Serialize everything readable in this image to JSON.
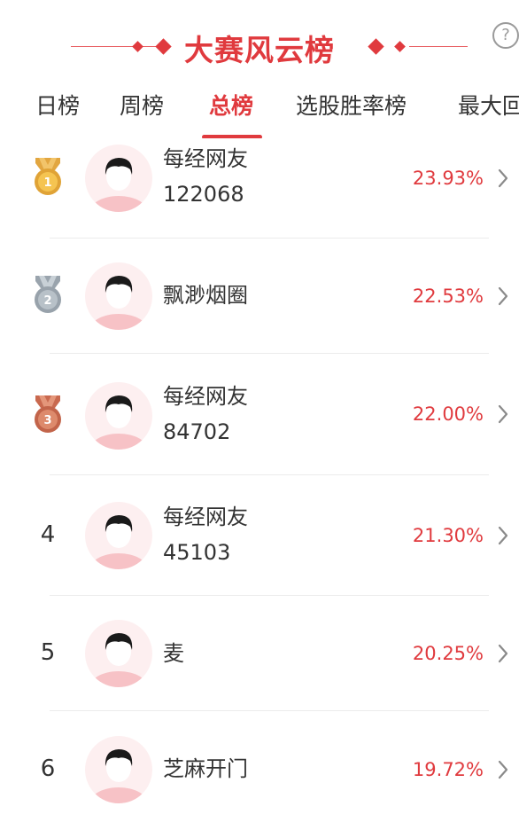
{
  "header": {
    "title": "大赛风云榜",
    "help_icon": "help-icon",
    "accent_color": "#e03a3e"
  },
  "tabs": [
    {
      "label": "日榜",
      "active": false
    },
    {
      "label": "周榜",
      "active": false
    },
    {
      "label": "总榜",
      "active": true
    },
    {
      "label": "选股胜率榜",
      "active": false
    },
    {
      "label": "最大回",
      "active": false
    }
  ],
  "leaderboard": [
    {
      "rank": "1",
      "rank_display": "medal-gold-icon",
      "name": "每经网友\n122068",
      "rate": "23.93%"
    },
    {
      "rank": "2",
      "rank_display": "medal-silver-icon",
      "name": "飘渺烟圈",
      "rate": "22.53%"
    },
    {
      "rank": "3",
      "rank_display": "medal-bronze-icon",
      "name": "每经网友\n84702",
      "rate": "22.00%"
    },
    {
      "rank": "4",
      "rank_display": "4",
      "name": "每经网友\n45103",
      "rate": "21.30%"
    },
    {
      "rank": "5",
      "rank_display": "5",
      "name": "麦",
      "rate": "20.25%"
    },
    {
      "rank": "6",
      "rank_display": "6",
      "name": "芝麻开门",
      "rate": "19.72%"
    }
  ]
}
